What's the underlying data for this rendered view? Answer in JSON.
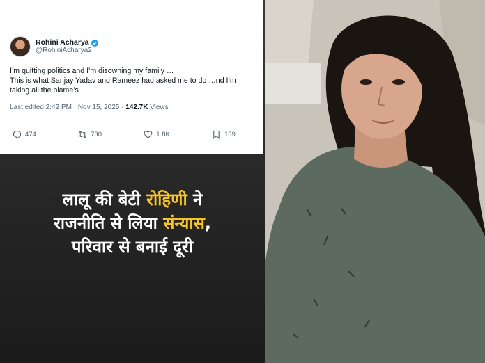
{
  "tweet": {
    "display_name": "Rohini Acharya",
    "handle": "@RohiniAcharya2",
    "body_lines": [
      "I’m quitting politics and I’m disowning my family …",
      "This is what Sanjay Yadav and Rameez had asked me to do …nd I’m",
      "taking all the blame’s"
    ],
    "meta_prefix": "Last edited 2:42 PM · Nov 15, 2025 · ",
    "views_count": "142.7K",
    "views_label": " Views",
    "replies": "474",
    "reposts": "730",
    "likes": "1.8K",
    "bookmarks": "139"
  },
  "headline": {
    "line1_a": "लालू की बेटी ",
    "line1_highlight": "रोहिणी",
    "line1_b": " ने",
    "line2_a": "राजनीति से लिया ",
    "line2_highlight": "संन्यास",
    "line2_b": ",",
    "line3": "परिवार से बनाई दूरी"
  },
  "colors": {
    "highlight": "#f6c428",
    "verified": "#1d9bf0"
  }
}
